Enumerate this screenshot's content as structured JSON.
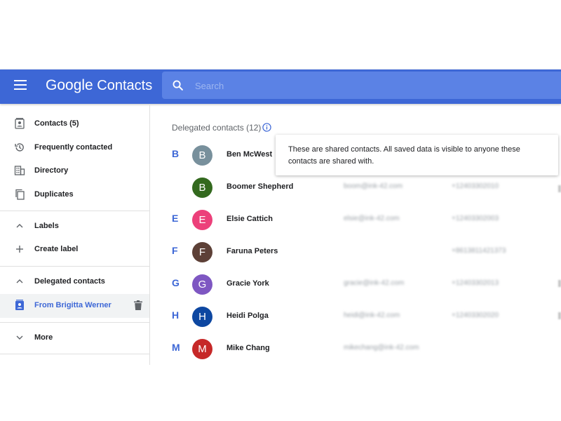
{
  "header": {
    "logo_google": "Google",
    "logo_contacts": "Contacts",
    "search_placeholder": "Search"
  },
  "sidebar": {
    "items": [
      {
        "label": "Contacts (5)",
        "icon": "contacts-icon"
      },
      {
        "label": "Frequently contacted",
        "icon": "history-icon"
      },
      {
        "label": "Directory",
        "icon": "directory-icon"
      },
      {
        "label": "Duplicates",
        "icon": "duplicates-icon"
      }
    ],
    "labels_header": "Labels",
    "create_label": "Create label",
    "delegated_header": "Delegated contacts",
    "delegated_item": "From Brigitta Werner",
    "more": "More"
  },
  "content": {
    "title": "Delegated contacts (12)",
    "tooltip": "These are shared contacts. All saved data is visible to anyone these contacts are shared with.",
    "contacts": [
      {
        "letter": "B",
        "initial": "B",
        "name": "Ben McWest",
        "email": "",
        "phone": "",
        "color": "#78909c"
      },
      {
        "letter": "",
        "initial": "B",
        "name": "Boomer Shepherd",
        "email": "boom@ink-42.com",
        "phone": "+12403302010",
        "color": "#33691e"
      },
      {
        "letter": "E",
        "initial": "E",
        "name": "Elsie Cattich",
        "email": "elsie@ink-42.com",
        "phone": "+12403302003",
        "color": "#ec407a"
      },
      {
        "letter": "F",
        "initial": "F",
        "name": "Faruna Peters",
        "email": "",
        "phone": "+8613811421373",
        "color": "#5d4037"
      },
      {
        "letter": "G",
        "initial": "G",
        "name": "Gracie York",
        "email": "gracie@ink-42.com",
        "phone": "+12403302013",
        "color": "#7e57c2"
      },
      {
        "letter": "H",
        "initial": "H",
        "name": "Heidi Polga",
        "email": "heidi@ink-42.com",
        "phone": "+12403302020",
        "color": "#0d47a1"
      },
      {
        "letter": "M",
        "initial": "M",
        "name": "Mike Chang",
        "email": "mikechang@ink-42.com",
        "phone": "",
        "color": "#c62828"
      }
    ]
  }
}
